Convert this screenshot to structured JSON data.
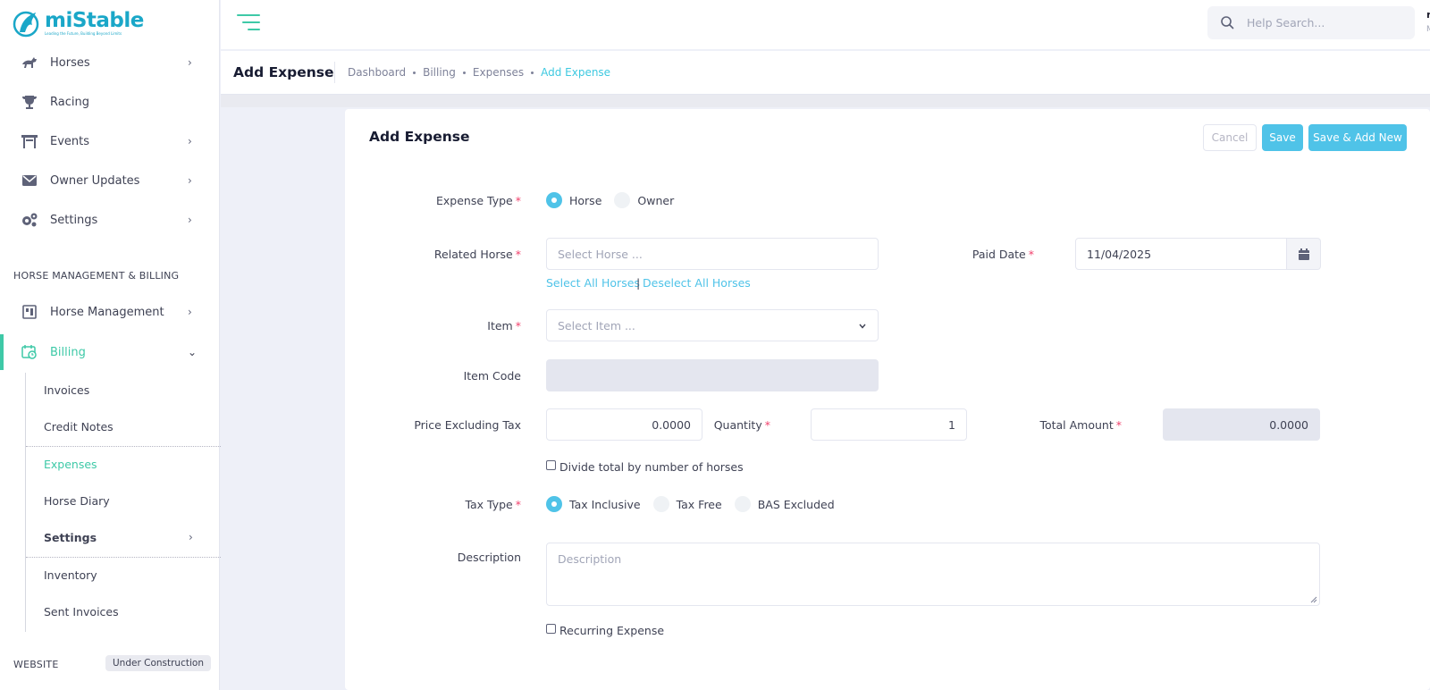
{
  "app": {
    "logo_name": "miStable",
    "logo_tagline": "Leading the Future, Building Beyond Limits",
    "accent": "#3ec9a7",
    "primary": "#4fc3e8"
  },
  "sidebar": {
    "items": [
      {
        "label": "Horses",
        "icon": "horse-icon",
        "chevron": "›"
      },
      {
        "label": "Racing",
        "icon": "trophy-icon",
        "chevron": ""
      },
      {
        "label": "Events",
        "icon": "gate-icon",
        "chevron": "›"
      },
      {
        "label": "Owner Updates",
        "icon": "envelope-icon",
        "chevron": "›"
      },
      {
        "label": "Settings",
        "icon": "gears-icon",
        "chevron": "›"
      }
    ],
    "section_title": "HORSE MANAGEMENT & BILLING",
    "management": {
      "label": "Horse Management",
      "icon": "stable-icon",
      "chevron": "›"
    },
    "billing": {
      "label": "Billing",
      "icon": "billing-icon",
      "chevron": "⌄"
    },
    "billing_sub": [
      {
        "label": "Invoices"
      },
      {
        "label": "Credit Notes"
      },
      {
        "label": "Expenses"
      },
      {
        "label": "Horse Diary"
      },
      {
        "label": "Settings",
        "chevron": "›"
      },
      {
        "label": "Inventory"
      },
      {
        "label": "Sent Invoices"
      }
    ],
    "website_title": "WEBSITE",
    "website_badge": "Under Construction"
  },
  "header": {
    "search_placeholder": "Help Search...",
    "user_initial": "r",
    "user_sub": "M"
  },
  "subheader": {
    "title": "Add Expense",
    "breadcrumb": [
      "Dashboard",
      "Billing",
      "Expenses",
      "Add Expense"
    ]
  },
  "form": {
    "title": "Add Expense",
    "buttons": {
      "cancel": "Cancel",
      "save": "Save",
      "save_new": "Save & Add New"
    },
    "expense_type": {
      "label": "Expense Type",
      "options": [
        "Horse",
        "Owner"
      ],
      "selected": "Horse"
    },
    "related_horse": {
      "label": "Related Horse",
      "placeholder": "Select Horse ...",
      "select_all": "Select All Horses",
      "separator": "|",
      "deselect_all": "Deselect All Horses"
    },
    "paid_date": {
      "label": "Paid Date",
      "value": "11/04/2025"
    },
    "item": {
      "label": "Item",
      "placeholder": "Select Item ..."
    },
    "item_code": {
      "label": "Item Code",
      "value": ""
    },
    "price": {
      "label": "Price Excluding Tax",
      "value": "0.0000"
    },
    "quantity": {
      "label": "Quantity",
      "value": "1"
    },
    "total": {
      "label": "Total Amount",
      "value": "0.0000"
    },
    "divide_total": {
      "label": "Divide total by number of horses",
      "checked": false
    },
    "tax_type": {
      "label": "Tax Type",
      "options": [
        "Tax Inclusive",
        "Tax Free",
        "BAS Excluded"
      ],
      "selected": "Tax Inclusive"
    },
    "description": {
      "label": "Description",
      "placeholder": "Description"
    },
    "recurring": {
      "label": "Recurring Expense",
      "checked": false
    }
  }
}
